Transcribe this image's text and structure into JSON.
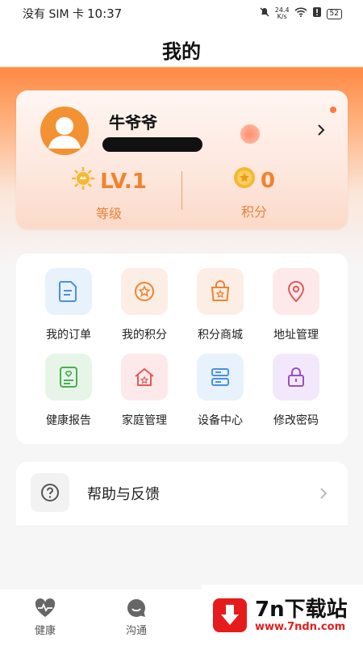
{
  "status_bar": {
    "carrier": "没有 SIM 卡",
    "time": "10:37",
    "net_speed_value": "24.4",
    "net_speed_unit": "K/s",
    "battery": "52"
  },
  "header": {
    "title": "我的"
  },
  "profile": {
    "name": "牛爷爷",
    "level": {
      "value": "LV.1",
      "label": "等级"
    },
    "points": {
      "value": "0",
      "label": "积分"
    }
  },
  "menu": {
    "items": [
      {
        "label": "我的订单",
        "icon": "order-icon",
        "color": "#4a90e2",
        "bg": "#e8f2fd"
      },
      {
        "label": "我的积分",
        "icon": "points-icon",
        "color": "#f0832e",
        "bg": "#fdeee5"
      },
      {
        "label": "积分商城",
        "icon": "shop-bag-icon",
        "color": "#f0832e",
        "bg": "#fdeee5"
      },
      {
        "label": "地址管理",
        "icon": "location-icon",
        "color": "#e35a5a",
        "bg": "#fde9e9"
      },
      {
        "label": "健康报告",
        "icon": "health-report-icon",
        "color": "#4caf50",
        "bg": "#e7f5e8"
      },
      {
        "label": "家庭管理",
        "icon": "home-icon",
        "color": "#e35a5a",
        "bg": "#fde9e9"
      },
      {
        "label": "设备中心",
        "icon": "device-icon",
        "color": "#4a90e2",
        "bg": "#e8f2fd"
      },
      {
        "label": "修改密码",
        "icon": "lock-icon",
        "color": "#9b4fc5",
        "bg": "#f3e8fb"
      }
    ]
  },
  "help": {
    "label": "帮助与反馈"
  },
  "bottom_nav": {
    "items": [
      {
        "label": "健康",
        "icon": "heart-pulse-icon"
      },
      {
        "label": "沟通",
        "icon": "chat-icon"
      }
    ]
  },
  "watermark": {
    "title": "7n下载站",
    "url": "www.7ndn.com"
  }
}
